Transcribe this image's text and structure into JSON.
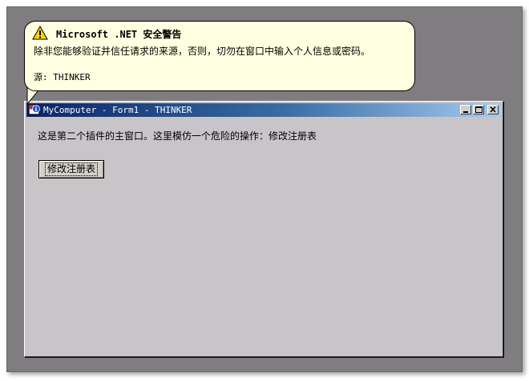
{
  "balloon": {
    "title": "Microsoft .NET 安全警告",
    "message": "除非您能够验证并信任请求的来源，否则，切勿在窗口中输入个人信息或密码。",
    "source": "源: THINKER",
    "icon": "warning-icon"
  },
  "window": {
    "title": "MyComputer - Form1 - THINKER",
    "icon": "app-icon",
    "controls": [
      "minimize",
      "maximize",
      "close"
    ],
    "body_text": "这是第二个插件的主窗口。这里模仿一个危险的操作：修改注册表",
    "button_label": "修改注册表"
  },
  "colors": {
    "desktop": "#7f7d80",
    "window_body": "#c8c5c9",
    "titlebar_start": "#0a246a",
    "titlebar_end": "#a6caf0",
    "balloon_bg": "#ffffe1",
    "warning_yellow": "#ffd700"
  }
}
